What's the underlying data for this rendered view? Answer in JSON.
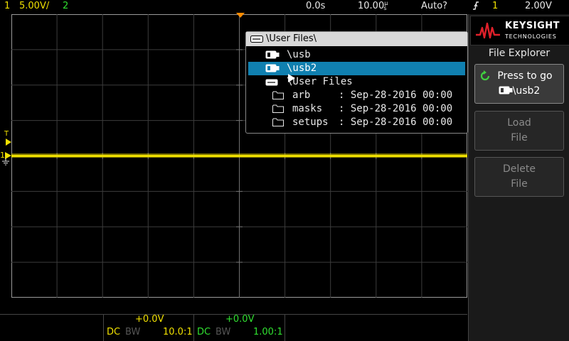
{
  "topbar": {
    "ch1_num": "1",
    "ch1_scale": "5.00V/",
    "ch2_num": "2",
    "time_delay": "0.0s",
    "time_scale": "10.00",
    "time_unit": "s",
    "time_unit_prefix": "µ",
    "trigger_mode": "Auto?",
    "trigger_src": "1",
    "trigger_level": "2.00V"
  },
  "markers": {
    "trigger_T": "T",
    "ch1_marker": "1"
  },
  "panel": {
    "logo_name": "KEYSIGHT",
    "logo_sub": "TECHNOLOGIES",
    "title": "File Explorer",
    "press_to_go_line1": "Press to go",
    "press_to_go_line2": "\\usb2",
    "load_line1": "Load",
    "load_line2": "File",
    "delete_line1": "Delete",
    "delete_line2": "File"
  },
  "explorer": {
    "title": "\\User Files\\",
    "rows": [
      {
        "name": "\\usb",
        "date": "",
        "selected": false
      },
      {
        "name": "\\usb2",
        "date": "",
        "selected": true
      },
      {
        "name": "\\User Files",
        "date": "",
        "selected": false
      },
      {
        "name": "arb",
        "date": ": Sep-28-2016 00:00",
        "selected": false
      },
      {
        "name": "masks",
        "date": ": Sep-28-2016 00:00",
        "selected": false
      },
      {
        "name": "setups",
        "date": ": Sep-28-2016 00:00",
        "selected": false
      }
    ]
  },
  "bottom": {
    "ch1_offset": "+0.0V",
    "ch1_coupling": "DC",
    "ch1_bw": "BW",
    "ch1_probe": "10.0:1",
    "ch2_offset": "+0.0V",
    "ch2_coupling": "DC",
    "ch2_bw": "BW",
    "ch2_probe": "1.00:1"
  },
  "colors": {
    "ch1": "#f0e000",
    "ch2": "#30e030",
    "selection": "#1080b0",
    "trigger_marker": "#ff8c00"
  }
}
